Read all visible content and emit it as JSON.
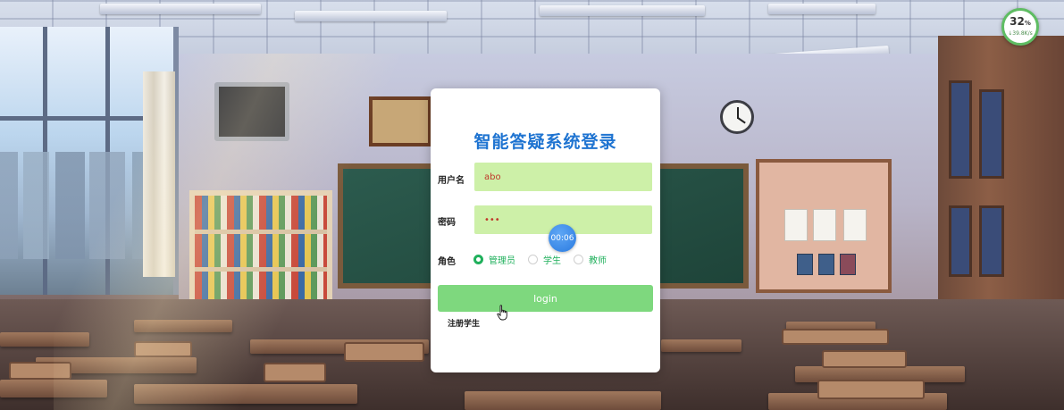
{
  "login": {
    "title": "智能答疑系统登录",
    "username_label": "用户名",
    "username_value": "abo",
    "password_label": "密码",
    "password_value": "•••",
    "role_label": "角色",
    "roles": [
      {
        "label": "管理员",
        "selected": true
      },
      {
        "label": "学生",
        "selected": false
      },
      {
        "label": "教师",
        "selected": false
      }
    ],
    "login_button": "login",
    "register_link": "注册学生"
  },
  "timer": {
    "text": "00:06"
  },
  "network_widget": {
    "percent": "32",
    "percent_unit": "%",
    "speed": "↓39.8K/s"
  },
  "colors": {
    "title": "#1f74d1",
    "input_bg": "#cdf0a8",
    "input_text": "#c0392b",
    "radio_accent": "#20b05c",
    "login_button": "#7ed87e",
    "timer": "#3a8ceb"
  },
  "icons": {
    "cursor": "hand-pointer-icon"
  }
}
